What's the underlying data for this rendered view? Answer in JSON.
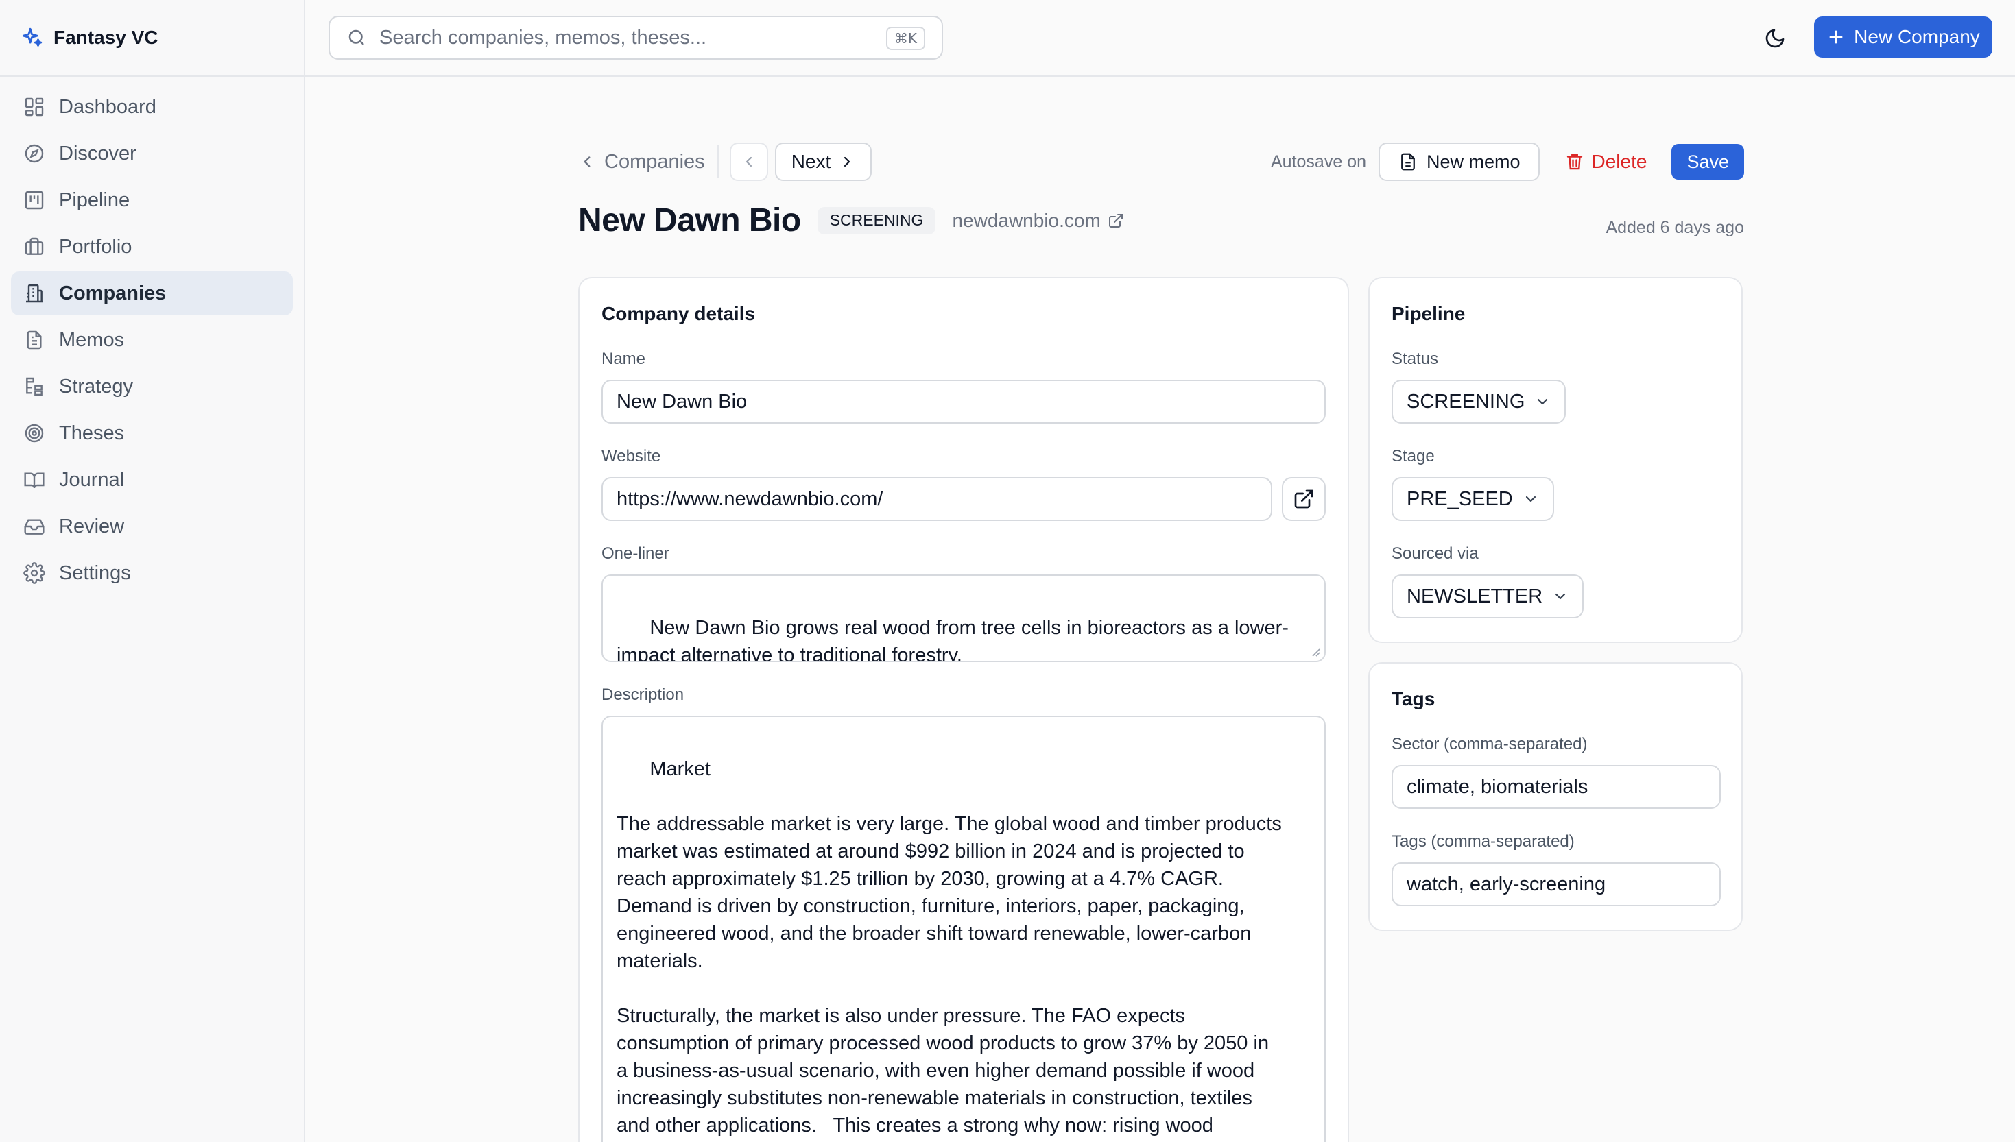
{
  "app": {
    "name": "Fantasy VC"
  },
  "sidebar": {
    "items": [
      {
        "label": "Dashboard",
        "icon": "dashboard-icon"
      },
      {
        "label": "Discover",
        "icon": "compass-icon"
      },
      {
        "label": "Pipeline",
        "icon": "kanban-icon"
      },
      {
        "label": "Portfolio",
        "icon": "briefcase-icon"
      },
      {
        "label": "Companies",
        "icon": "building-icon",
        "active": true
      },
      {
        "label": "Memos",
        "icon": "document-icon"
      },
      {
        "label": "Strategy",
        "icon": "strategy-icon"
      },
      {
        "label": "Theses",
        "icon": "target-icon"
      },
      {
        "label": "Journal",
        "icon": "book-icon"
      },
      {
        "label": "Review",
        "icon": "inbox-icon"
      },
      {
        "label": "Settings",
        "icon": "gear-icon"
      }
    ]
  },
  "search": {
    "placeholder": "Search companies, memos, theses...",
    "shortcut": "⌘K"
  },
  "topbar": {
    "new_company_label": "New Company"
  },
  "breadcrumb": {
    "back_label": "Companies",
    "next_label": "Next"
  },
  "actions": {
    "autosave": "Autosave on",
    "new_memo": "New memo",
    "delete": "Delete",
    "save": "Save"
  },
  "company": {
    "title": "New Dawn Bio",
    "status": "SCREENING",
    "domain": "newdawnbio.com",
    "added": "Added 6 days ago"
  },
  "details": {
    "heading": "Company details",
    "name_label": "Name",
    "name_value": "New Dawn Bio",
    "website_label": "Website",
    "website_value": "https://www.newdawnbio.com/",
    "oneliner_label": "One-liner",
    "oneliner_value": "New Dawn Bio grows real wood from tree cells in bioreactors as a lower-\nimpact alternative to traditional forestry.",
    "description_label": "Description",
    "description_value": "Market\n\nThe addressable market is very large. The global wood and timber products\nmarket was estimated at around $992 billion in 2024 and is projected to\nreach approximately $1.25 trillion by 2030, growing at a 4.7% CAGR.\nDemand is driven by construction, furniture, interiors, paper, packaging,\nengineered wood, and the broader shift toward renewable, lower-carbon\nmaterials.\n\nStructurally, the market is also under pressure. The FAO expects\nconsumption of primary processed wood products to grow 37% by 2050 in\na business-as-usual scenario, with even higher demand possible if wood\nincreasingly substitutes non-renewable materials in construction, textiles\nand other applications.   This creates a strong why now: rising wood\ndemand, sustainability regulation, pressure on forests, and growing"
  },
  "pipeline": {
    "heading": "Pipeline",
    "status_label": "Status",
    "status_value": "SCREENING",
    "stage_label": "Stage",
    "stage_value": "PRE_SEED",
    "sourced_label": "Sourced via",
    "sourced_value": "NEWSLETTER"
  },
  "tags": {
    "heading": "Tags",
    "sector_label": "Sector (comma-separated)",
    "sector_value": "climate, biomaterials",
    "tags_label": "Tags (comma-separated)",
    "tags_value": "watch, early-screening"
  },
  "colors": {
    "accent": "#2b63d9",
    "danger": "#dc2626",
    "active_nav": "#e6ebf3"
  }
}
